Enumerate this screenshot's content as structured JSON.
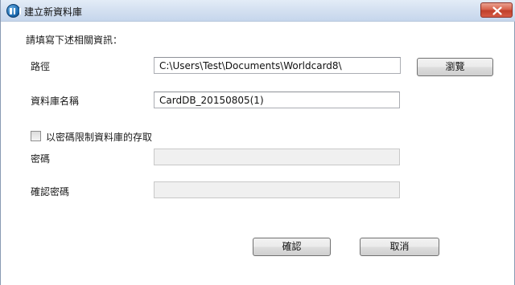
{
  "window": {
    "title": "建立新資料庫",
    "close_label": "×"
  },
  "form": {
    "instruction": "請填寫下述相關資訊：",
    "path": {
      "label": "路徑",
      "value": "C:\\Users\\Test\\Documents\\Worldcard8\\",
      "browse_label": "瀏覽"
    },
    "db_name": {
      "label": "資料庫名稱",
      "value": "CardDB_20150805(1)"
    },
    "password_protect": {
      "label": "以密碼限制資料庫的存取",
      "checked": false
    },
    "password": {
      "label": "密碼",
      "value": ""
    },
    "confirm_password": {
      "label": "確認密碼",
      "value": ""
    }
  },
  "buttons": {
    "ok_label": "確認",
    "cancel_label": "取消"
  },
  "colors": {
    "close_button": "#c8452f",
    "titlebar": "#d2dff0",
    "disabled_field": "#f0f0f0"
  }
}
